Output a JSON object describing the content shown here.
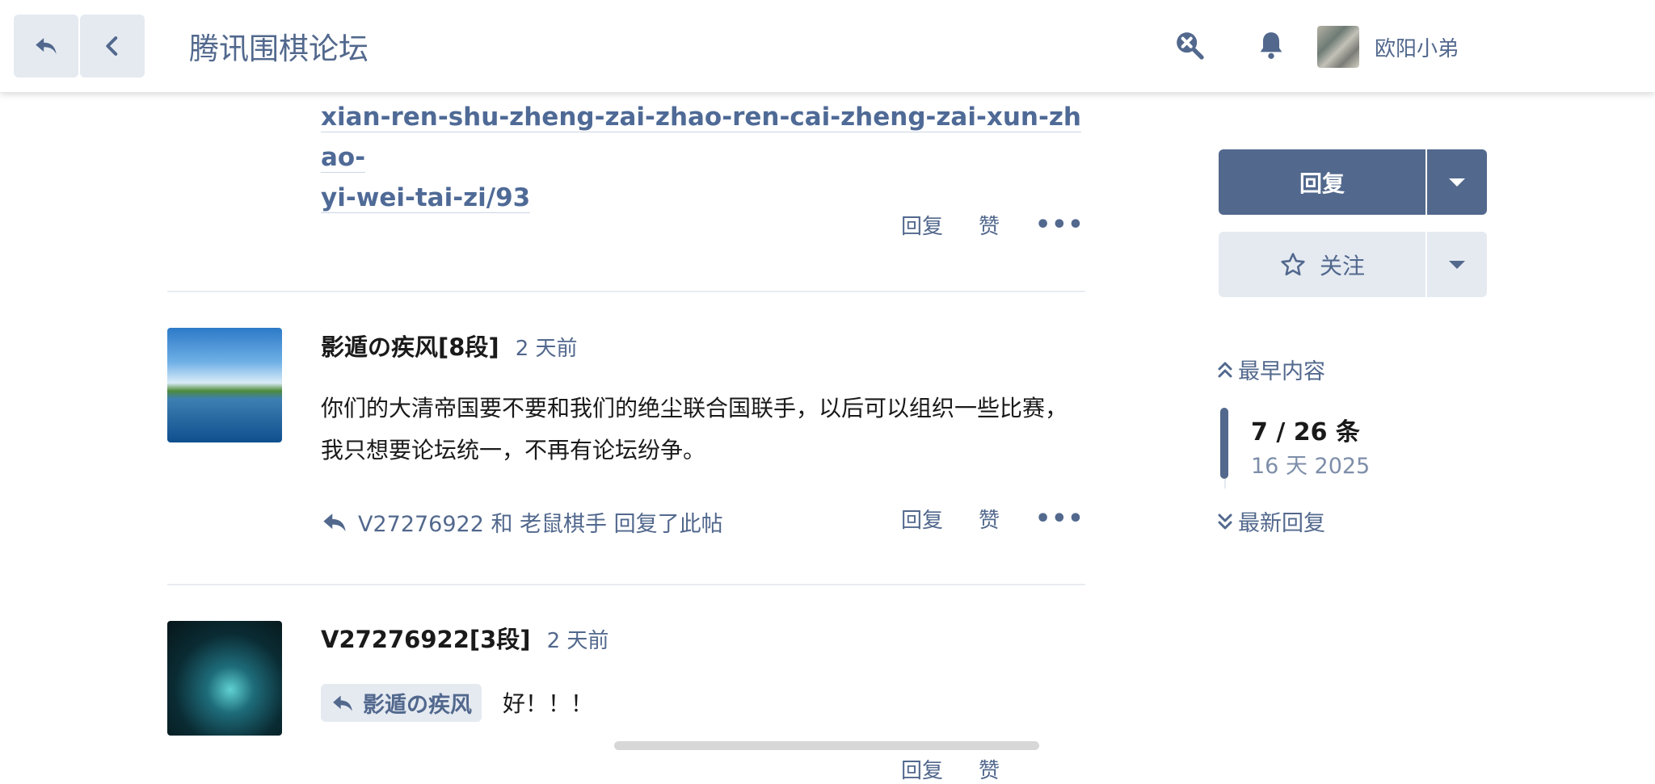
{
  "header": {
    "site_title": "腾讯围棋论坛",
    "username": "欧阳小弟",
    "icons": [
      "reply-arrow-icon",
      "chevron-left-icon",
      "search-icon",
      "bell-icon"
    ]
  },
  "prev_post": {
    "link_line1": "xian-ren-shu-zheng-zai-zhao-ren-cai-zheng-zai-xun-zhao-",
    "link_line2": "yi-wei-tai-zi/93",
    "actions": {
      "reply": "回复",
      "like": "赞",
      "more": "•••"
    }
  },
  "post1": {
    "author": "影遁の疾风[8段]",
    "time": "2 天前",
    "body": "你们的大清帝国要不要和我们的绝尘联合国联手，以后可以组织一些比赛，我只想要论坛统一，不再有论坛纷争。",
    "replied_by": "V27276922 和 老鼠棋手 回复了此帖",
    "actions": {
      "reply": "回复",
      "like": "赞",
      "more": "•••"
    }
  },
  "post2": {
    "author": "V27276922[3段]",
    "time": "2 天前",
    "reply_to": "影遁の疾风",
    "body": "好！！！",
    "actions": {
      "reply": "回复",
      "like": "赞"
    }
  },
  "sidebar": {
    "reply_label": "回复",
    "follow_label": "关注",
    "earliest_label": "最早内容",
    "latest_label": "最新回复",
    "count": "7 / 26 条",
    "date": "16 天 2025"
  },
  "colors": {
    "accent": "#52688d",
    "button_light": "#e5eaf1",
    "text": "#1a1a1a"
  }
}
